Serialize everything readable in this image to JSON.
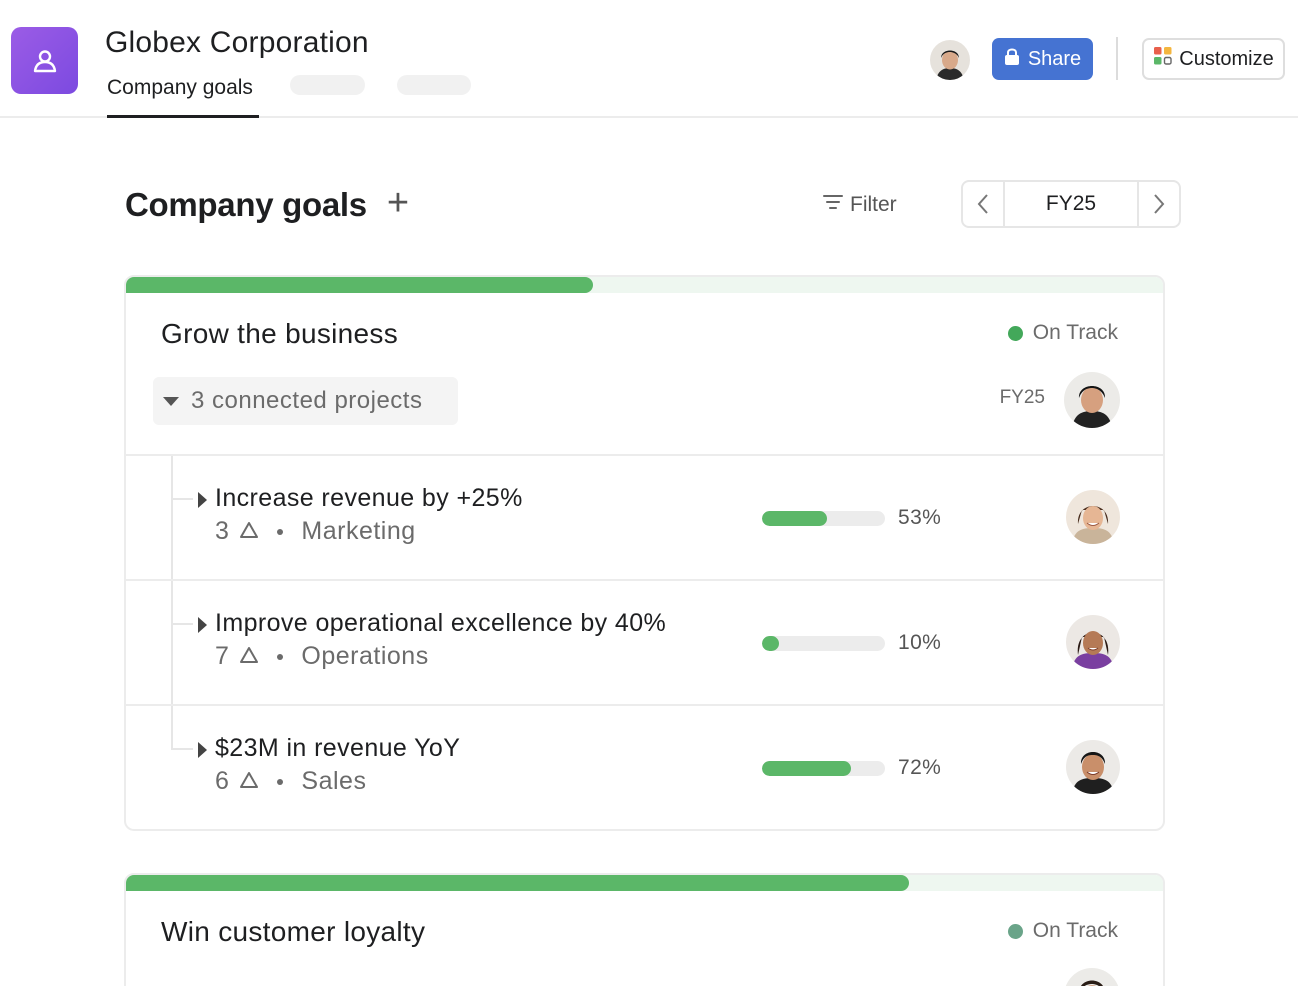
{
  "header": {
    "org_name": "Globex Corporation",
    "active_tab": "Company goals",
    "share_label": "Share",
    "customize_label": "Customize",
    "app_icon": "team-icon",
    "share_icon": "lock-icon",
    "customize_icon": "grid-icon",
    "accent_color": "#8d54e4",
    "share_color": "#4573d2"
  },
  "page": {
    "title": "Company goals",
    "add_symbol": "+",
    "filter_label": "Filter",
    "period": "FY25"
  },
  "goals": [
    {
      "title": "Grow the business",
      "status": "On Track",
      "status_color": "#43a85a",
      "progress": 0.45,
      "projects_label": "3 connected projects",
      "period": "FY25",
      "subgoals": [
        {
          "title": "Increase revenue by +25%",
          "count": "3",
          "team": "Marketing",
          "progress_pct": "53%",
          "progress": 0.53
        },
        {
          "title": "Improve operational excellence by 40%",
          "count": "7",
          "team": "Operations",
          "progress_pct": "10%",
          "progress": 0.1
        },
        {
          "title": "$23M in revenue YoY",
          "count": "6",
          "team": "Sales",
          "progress_pct": "72%",
          "progress": 0.72
        }
      ]
    },
    {
      "title": "Win customer loyalty",
      "status": "On Track",
      "status_color": "#6aa489",
      "progress": 0.755
    }
  ]
}
